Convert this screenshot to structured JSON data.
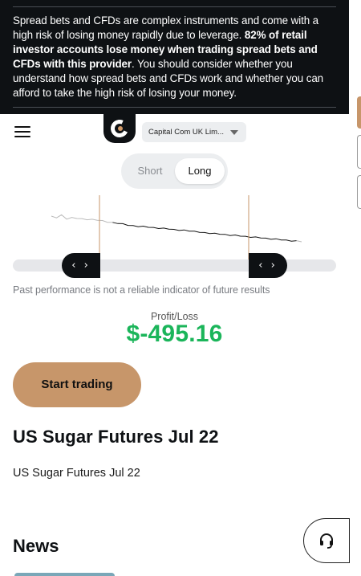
{
  "risk_warning": {
    "text_before": "Spread bets and CFDs are complex instruments and come with a high risk of losing money rapidly due to leverage. ",
    "text_bold": "82% of retail investor accounts lose money when trading spread bets and CFDs with this provider",
    "text_after": ". You should consider whether you understand how spread bets and CFDs work and whether you can afford to take the high risk of losing your money."
  },
  "header": {
    "menu_icon": "hamburger-menu-icon",
    "logo_icon": "capital-com-logo",
    "entity_select": "Capital Com UK Lim..."
  },
  "toggle": {
    "short_label": "Short",
    "long_label": "Long",
    "selected": "Long"
  },
  "chart_data": {
    "type": "line",
    "title": "",
    "xlabel": "",
    "ylabel": "",
    "series": [
      {
        "values": [
          62,
          63,
          64,
          61,
          60,
          62,
          58,
          60,
          57,
          59,
          55,
          56,
          52,
          54,
          50,
          51,
          47,
          49,
          46,
          48,
          44,
          46,
          43,
          45,
          41,
          43,
          40,
          42,
          38,
          40,
          36,
          38,
          35,
          37,
          33,
          35,
          32,
          34,
          30,
          32,
          29,
          31,
          27,
          29,
          26,
          28,
          24,
          26,
          23,
          25
        ]
      }
    ],
    "selection": {
      "start_index": 12,
      "end_index": 48
    },
    "colors": {
      "line": "#111111",
      "faded_line": "#bbbbbb",
      "marker": "#c7966a"
    }
  },
  "range_handles": {
    "left_glyph": "‹ ›",
    "right_glyph": "‹ ›"
  },
  "disclaimer": "Past performance is not a reliable indicator of future results",
  "profit_loss": {
    "label": "Profit/Loss",
    "value": "$-495.16",
    "color": "#1bb55a"
  },
  "cta": {
    "label": "Start trading",
    "color": "#c7966a"
  },
  "instrument": {
    "title": "US Sugar Futures Jul 22",
    "subtitle": "US Sugar Futures Jul 22"
  },
  "news": {
    "heading": "News"
  },
  "support": {
    "icon": "headset-support-icon"
  }
}
